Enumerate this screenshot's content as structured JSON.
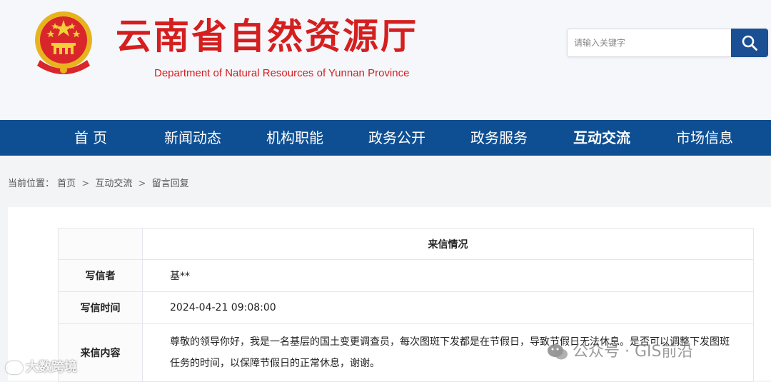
{
  "header": {
    "title": "云南省自然资源厅",
    "subtitle": "Department of Natural Resources of Yunnan Province"
  },
  "search": {
    "placeholder": "请输入关键字"
  },
  "nav": {
    "items": [
      {
        "label": "首 页"
      },
      {
        "label": "新闻动态"
      },
      {
        "label": "机构职能"
      },
      {
        "label": "政务公开"
      },
      {
        "label": "政务服务"
      },
      {
        "label": "互动交流",
        "active": true
      },
      {
        "label": "市场信息"
      }
    ]
  },
  "breadcrumb": {
    "prefix": "当前位置：",
    "items": [
      "首页",
      "互动交流",
      "留言回复"
    ],
    "separator": ">"
  },
  "letter": {
    "section_title": "来信情况",
    "rows": [
      {
        "label": "写信者",
        "value": "基**"
      },
      {
        "label": "写信时间",
        "value": "2024-04-21 09:08:00"
      },
      {
        "label": "来信内容",
        "value": "尊敬的领导你好，我是一名基层的国土变更调查员，每次图斑下发都是在节假日，导致节假日无法休息。是否可以调整下发图斑任务的时间，以保障节假日的正常休息，谢谢。"
      }
    ]
  },
  "watermarks": {
    "left": "大数跨境",
    "right": "公众号 · GIS前沿"
  },
  "colors": {
    "brand_red": "#d51f1f",
    "nav_blue": "#0e4f93",
    "search_blue": "#1b4f93"
  }
}
